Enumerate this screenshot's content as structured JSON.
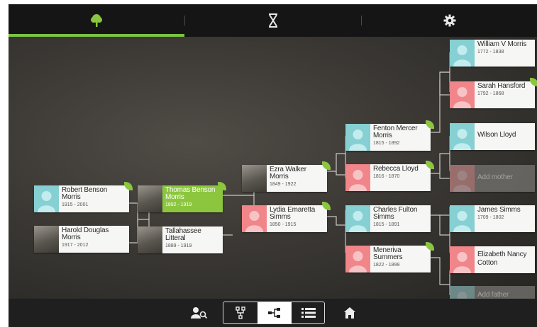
{
  "top_tabs": [
    {
      "id": "tree",
      "icon": "tree-icon",
      "active": true
    },
    {
      "id": "timeline",
      "icon": "hourglass-icon",
      "active": false
    },
    {
      "id": "settings",
      "icon": "gear-icon",
      "active": false
    }
  ],
  "colors": {
    "accent": "#8cc63f",
    "male": "#86d0d3",
    "female": "#f0868a",
    "card": "#f6f6f4",
    "background": "#2c2b28"
  },
  "people": {
    "robert": {
      "name": "Robert Benson Morris",
      "dates": "1915 - 2001"
    },
    "harold": {
      "name": "Harold Douglas Morris",
      "dates": "1917 - 2012"
    },
    "thomas": {
      "name": "Thomas Benson Morris",
      "dates": "1892 - 1919"
    },
    "tallahassee": {
      "name": "Tallahassee Litteral",
      "dates": "1889 - 1919"
    },
    "ezra": {
      "name": "Ezra Walker Morris",
      "dates": "1849 - 1922"
    },
    "lydia": {
      "name": "Lydia Emaretta Simms",
      "dates": "1850 - 1915"
    },
    "fenton": {
      "name": "Fenton Mercer Morris",
      "dates": "1815 - 1892"
    },
    "rebecca": {
      "name": "Rebecca Lloyd",
      "dates": "1816 - 1870"
    },
    "charles": {
      "name": "Charles Fulton Simms",
      "dates": "1815 - 1891"
    },
    "meneriva": {
      "name": "Meneriva Summers",
      "dates": "1822 - 1899"
    },
    "william": {
      "name": "William V Morris",
      "dates": "1772 - 1838"
    },
    "sarah": {
      "name": "Sarah Hansford",
      "dates": "1792 - 1868"
    },
    "wilson": {
      "name": "Wilson Lloyd",
      "dates": ""
    },
    "add_mother": {
      "name": "Add mother",
      "dates": ""
    },
    "james": {
      "name": "James Simms",
      "dates": "1709 - 1802"
    },
    "elizabeth": {
      "name": "Elizabeth Nancy Cotton",
      "dates": ""
    },
    "add_father": {
      "name": "Add father",
      "dates": ""
    }
  },
  "bottom_bar": {
    "search_person_icon": "person-search-icon",
    "views": [
      {
        "id": "pedigree",
        "icon": "pedigree-view-icon",
        "active": false
      },
      {
        "id": "tree",
        "icon": "tree-view-icon",
        "active": true
      },
      {
        "id": "list",
        "icon": "list-view-icon",
        "active": false
      }
    ],
    "home_icon": "home-icon"
  }
}
